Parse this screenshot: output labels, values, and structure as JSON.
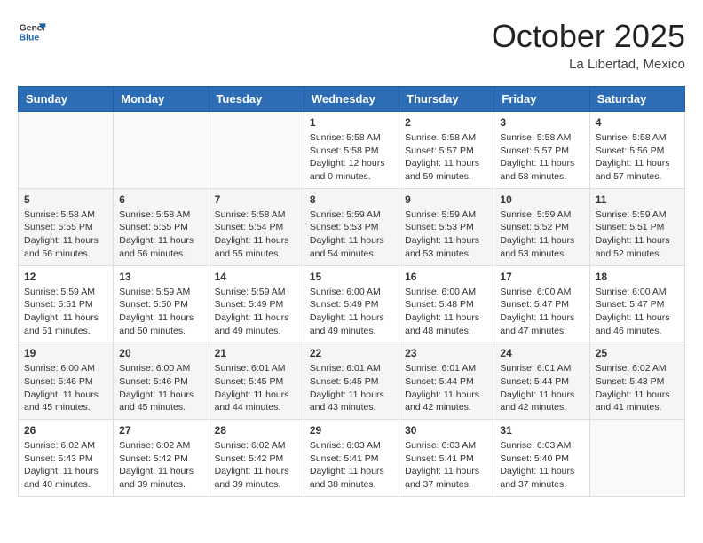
{
  "header": {
    "logo": {
      "line1": "General",
      "line2": "Blue"
    },
    "title": "October 2025",
    "subtitle": "La Libertad, Mexico"
  },
  "weekdays": [
    "Sunday",
    "Monday",
    "Tuesday",
    "Wednesday",
    "Thursday",
    "Friday",
    "Saturday"
  ],
  "weeks": [
    [
      {
        "day": "",
        "info": ""
      },
      {
        "day": "",
        "info": ""
      },
      {
        "day": "",
        "info": ""
      },
      {
        "day": "1",
        "info": "Sunrise: 5:58 AM\nSunset: 5:58 PM\nDaylight: 12 hours\nand 0 minutes."
      },
      {
        "day": "2",
        "info": "Sunrise: 5:58 AM\nSunset: 5:57 PM\nDaylight: 11 hours\nand 59 minutes."
      },
      {
        "day": "3",
        "info": "Sunrise: 5:58 AM\nSunset: 5:57 PM\nDaylight: 11 hours\nand 58 minutes."
      },
      {
        "day": "4",
        "info": "Sunrise: 5:58 AM\nSunset: 5:56 PM\nDaylight: 11 hours\nand 57 minutes."
      }
    ],
    [
      {
        "day": "5",
        "info": "Sunrise: 5:58 AM\nSunset: 5:55 PM\nDaylight: 11 hours\nand 56 minutes."
      },
      {
        "day": "6",
        "info": "Sunrise: 5:58 AM\nSunset: 5:55 PM\nDaylight: 11 hours\nand 56 minutes."
      },
      {
        "day": "7",
        "info": "Sunrise: 5:58 AM\nSunset: 5:54 PM\nDaylight: 11 hours\nand 55 minutes."
      },
      {
        "day": "8",
        "info": "Sunrise: 5:59 AM\nSunset: 5:53 PM\nDaylight: 11 hours\nand 54 minutes."
      },
      {
        "day": "9",
        "info": "Sunrise: 5:59 AM\nSunset: 5:53 PM\nDaylight: 11 hours\nand 53 minutes."
      },
      {
        "day": "10",
        "info": "Sunrise: 5:59 AM\nSunset: 5:52 PM\nDaylight: 11 hours\nand 53 minutes."
      },
      {
        "day": "11",
        "info": "Sunrise: 5:59 AM\nSunset: 5:51 PM\nDaylight: 11 hours\nand 52 minutes."
      }
    ],
    [
      {
        "day": "12",
        "info": "Sunrise: 5:59 AM\nSunset: 5:51 PM\nDaylight: 11 hours\nand 51 minutes."
      },
      {
        "day": "13",
        "info": "Sunrise: 5:59 AM\nSunset: 5:50 PM\nDaylight: 11 hours\nand 50 minutes."
      },
      {
        "day": "14",
        "info": "Sunrise: 5:59 AM\nSunset: 5:49 PM\nDaylight: 11 hours\nand 49 minutes."
      },
      {
        "day": "15",
        "info": "Sunrise: 6:00 AM\nSunset: 5:49 PM\nDaylight: 11 hours\nand 49 minutes."
      },
      {
        "day": "16",
        "info": "Sunrise: 6:00 AM\nSunset: 5:48 PM\nDaylight: 11 hours\nand 48 minutes."
      },
      {
        "day": "17",
        "info": "Sunrise: 6:00 AM\nSunset: 5:47 PM\nDaylight: 11 hours\nand 47 minutes."
      },
      {
        "day": "18",
        "info": "Sunrise: 6:00 AM\nSunset: 5:47 PM\nDaylight: 11 hours\nand 46 minutes."
      }
    ],
    [
      {
        "day": "19",
        "info": "Sunrise: 6:00 AM\nSunset: 5:46 PM\nDaylight: 11 hours\nand 45 minutes."
      },
      {
        "day": "20",
        "info": "Sunrise: 6:00 AM\nSunset: 5:46 PM\nDaylight: 11 hours\nand 45 minutes."
      },
      {
        "day": "21",
        "info": "Sunrise: 6:01 AM\nSunset: 5:45 PM\nDaylight: 11 hours\nand 44 minutes."
      },
      {
        "day": "22",
        "info": "Sunrise: 6:01 AM\nSunset: 5:45 PM\nDaylight: 11 hours\nand 43 minutes."
      },
      {
        "day": "23",
        "info": "Sunrise: 6:01 AM\nSunset: 5:44 PM\nDaylight: 11 hours\nand 42 minutes."
      },
      {
        "day": "24",
        "info": "Sunrise: 6:01 AM\nSunset: 5:44 PM\nDaylight: 11 hours\nand 42 minutes."
      },
      {
        "day": "25",
        "info": "Sunrise: 6:02 AM\nSunset: 5:43 PM\nDaylight: 11 hours\nand 41 minutes."
      }
    ],
    [
      {
        "day": "26",
        "info": "Sunrise: 6:02 AM\nSunset: 5:43 PM\nDaylight: 11 hours\nand 40 minutes."
      },
      {
        "day": "27",
        "info": "Sunrise: 6:02 AM\nSunset: 5:42 PM\nDaylight: 11 hours\nand 39 minutes."
      },
      {
        "day": "28",
        "info": "Sunrise: 6:02 AM\nSunset: 5:42 PM\nDaylight: 11 hours\nand 39 minutes."
      },
      {
        "day": "29",
        "info": "Sunrise: 6:03 AM\nSunset: 5:41 PM\nDaylight: 11 hours\nand 38 minutes."
      },
      {
        "day": "30",
        "info": "Sunrise: 6:03 AM\nSunset: 5:41 PM\nDaylight: 11 hours\nand 37 minutes."
      },
      {
        "day": "31",
        "info": "Sunrise: 6:03 AM\nSunset: 5:40 PM\nDaylight: 11 hours\nand 37 minutes."
      },
      {
        "day": "",
        "info": ""
      }
    ]
  ]
}
